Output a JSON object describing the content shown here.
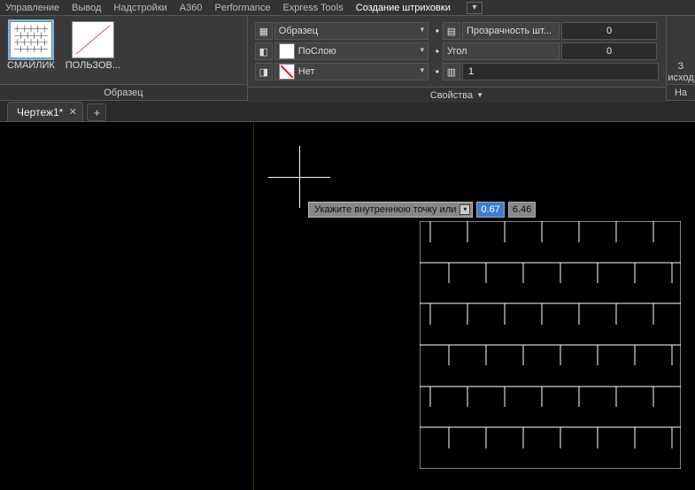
{
  "ribbon_tabs": {
    "t0": "Управление",
    "t1": "Вывод",
    "t2": "Надстройки",
    "t3": "A360",
    "t4": "Performance",
    "t5": "Express Tools",
    "t6": "Создание штриховки"
  },
  "panel_pattern": {
    "title": "Образец",
    "item0": "СМАЙЛИК",
    "item1": "ПОЛЬЗОВ..."
  },
  "panel_props": {
    "title": "Свойства",
    "pattern_label": "Образец",
    "color_label": "ПоСлою",
    "bg_label": "Нет"
  },
  "panel_right": {
    "transp_label": "Прозрачность шт...",
    "transp_value": "0",
    "angle_label": "Угол",
    "angle_value": "0",
    "scale_value": "1"
  },
  "panel_far": {
    "line1": "З",
    "line2": "исход",
    "title": "На"
  },
  "doc_tab": {
    "name": "Чертеж1*"
  },
  "prompt": {
    "text": "Укажите внутреннюю точку или",
    "v1": "0.67",
    "v2": "6.46"
  }
}
